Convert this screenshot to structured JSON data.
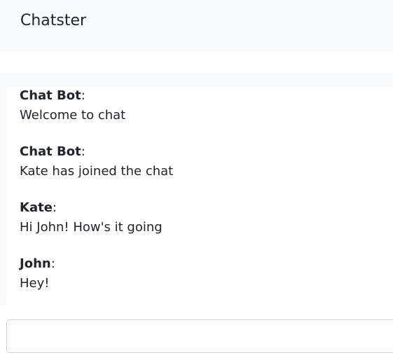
{
  "app": {
    "title": "Chatster"
  },
  "messages": [
    {
      "author": "Chat Bot",
      "text": "Welcome to chat"
    },
    {
      "author": "Chat Bot",
      "text": "Kate has joined the chat"
    },
    {
      "author": "Kate",
      "text": "Hi John! How's it going"
    },
    {
      "author": "John",
      "text": "Hey!"
    }
  ],
  "composer": {
    "value": "",
    "placeholder": ""
  }
}
